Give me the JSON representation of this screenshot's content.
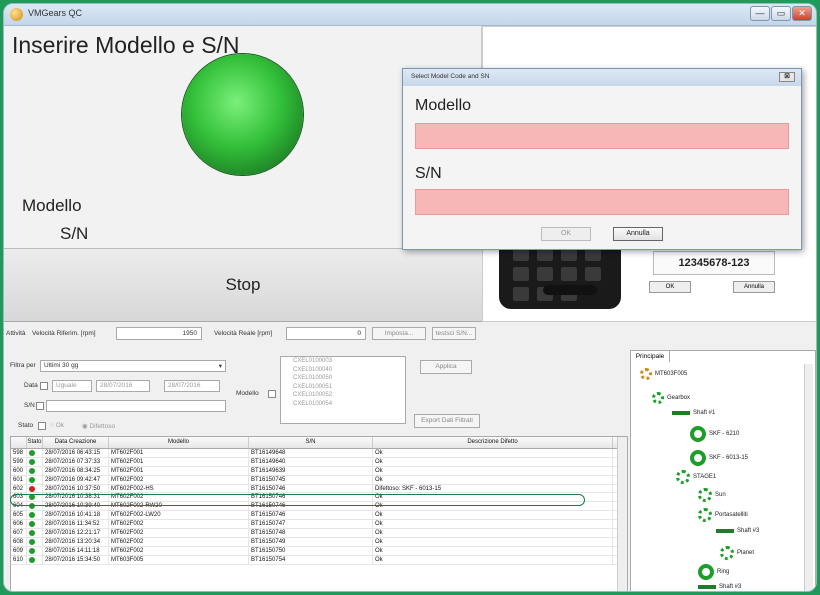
{
  "window": {
    "title": "VMGears QC",
    "controls": [
      "—",
      "▭",
      "✕"
    ]
  },
  "main": {
    "heading": "Inserire Modello e S/N",
    "model_label": "Modello",
    "sn_label": "S/N",
    "stop_label": "Stop",
    "indicator_color": "#33c03a"
  },
  "camera": {
    "sn_readout": "12345678-123",
    "ok_label": "OK",
    "cancel_label": "Annulla"
  },
  "dialog": {
    "title": "Select Model Code and SN",
    "model_label": "Modello",
    "sn_label": "S/N",
    "model_value": "",
    "sn_value": "",
    "ok_label": "OK",
    "cancel_label": "Annulla",
    "field_color": "#f7b7b7"
  },
  "speed": {
    "activity_label": "Attività",
    "ref_label": "Velocità Riferim. [rpm]",
    "ref_value": "1950",
    "real_label": "Velocità Reale [rpm]",
    "real_value": "0",
    "set_button": "Imposta...",
    "sn_button": "testsci S/N..."
  },
  "filter": {
    "filter_label": "Filtra per",
    "filter_value": "Ultimi 30 gg",
    "date_label": "Data",
    "date_op": "Uguale",
    "date_from": "28/07/2016",
    "date_to": "28/07/2016",
    "sn_label": "S/N",
    "state_label": "Stato",
    "ok_option": "Ok",
    "defect_option": "Difettoso",
    "model_label": "Modello",
    "model_list": [
      "CXEL0100003",
      "CXEL0100040",
      "CXEL0100050",
      "CXEL0100051",
      "CXEL0100052",
      "CXEL0100054"
    ],
    "apply_button": "Applica",
    "export_button": "Export Dati Filtrati"
  },
  "table": {
    "headers": [
      "",
      "Stato",
      "Data Creazione",
      "Modello",
      "S/N",
      "Descrizione Difetto"
    ],
    "rows": [
      {
        "id": "598",
        "status": "ok",
        "date": "28/07/2016 06:43:15",
        "model": "MT602F001",
        "sn": "BT16149648",
        "desc": "Ok"
      },
      {
        "id": "599",
        "status": "ok",
        "date": "28/07/2016 07:37:33",
        "model": "MT602F001",
        "sn": "BT16149640",
        "desc": "Ok"
      },
      {
        "id": "600",
        "status": "ok",
        "date": "28/07/2016 08:34:25",
        "model": "MT602F001",
        "sn": "BT16149639",
        "desc": "Ok"
      },
      {
        "id": "601",
        "status": "ok",
        "date": "28/07/2016 09:42:47",
        "model": "MT602F002",
        "sn": "BT16150745",
        "desc": "Ok"
      },
      {
        "id": "602",
        "status": "defect",
        "date": "28/07/2016 10:37:50",
        "model": "MT602F002-HS",
        "sn": "BT16150746",
        "desc": "Difettoso: SKF - 6013-15"
      },
      {
        "id": "603",
        "status": "ok",
        "date": "28/07/2016 10:38:31",
        "model": "MT602F002",
        "sn": "BT16150746",
        "desc": "Ok"
      },
      {
        "id": "604",
        "status": "ok",
        "date": "28/07/2016 10:39:40",
        "model": "MT602F002-RW20",
        "sn": "BT16150746",
        "desc": "Ok"
      },
      {
        "id": "605",
        "status": "ok",
        "date": "28/07/2016 10:41:18",
        "model": "MT602F002-LW20",
        "sn": "BT16150746",
        "desc": "Ok"
      },
      {
        "id": "606",
        "status": "ok",
        "date": "28/07/2016 11:34:52",
        "model": "MT602F002",
        "sn": "BT16150747",
        "desc": "Ok"
      },
      {
        "id": "607",
        "status": "ok",
        "date": "28/07/2016 12:21:17",
        "model": "MT602F002",
        "sn": "BT16150748",
        "desc": "Ok"
      },
      {
        "id": "608",
        "status": "ok",
        "date": "28/07/2016 13:20:34",
        "model": "MT602F002",
        "sn": "BT16150749",
        "desc": "Ok"
      },
      {
        "id": "609",
        "status": "ok",
        "date": "28/07/2016 14:11:18",
        "model": "MT602F002",
        "sn": "BT16150750",
        "desc": "Ok"
      },
      {
        "id": "610",
        "status": "ok",
        "date": "28/07/2016 15:34:50",
        "model": "MT603F005",
        "sn": "BT16150754",
        "desc": "Ok"
      }
    ],
    "ok_color": "#1f9d2a",
    "defect_color": "#d62020"
  },
  "tree": {
    "tab": "Principale",
    "nodes": [
      {
        "label": "MT603F005",
        "kind": "root"
      },
      {
        "label": "Gearbox",
        "kind": "gearbox"
      },
      {
        "label": "Shaft #1",
        "kind": "shaft"
      },
      {
        "label": "SKF - 6210",
        "kind": "bearing"
      },
      {
        "label": "SKF - 6013-15",
        "kind": "bearing"
      },
      {
        "label": "STAGE1",
        "kind": "gear"
      },
      {
        "label": "Sun",
        "kind": "gear"
      },
      {
        "label": "Portasatelliti",
        "kind": "gear"
      },
      {
        "label": "Shaft #3",
        "kind": "shaft"
      },
      {
        "label": "Planet",
        "kind": "gear"
      },
      {
        "label": "Ring",
        "kind": "bearing"
      },
      {
        "label": "Shaft #3",
        "kind": "shaft"
      }
    ]
  }
}
